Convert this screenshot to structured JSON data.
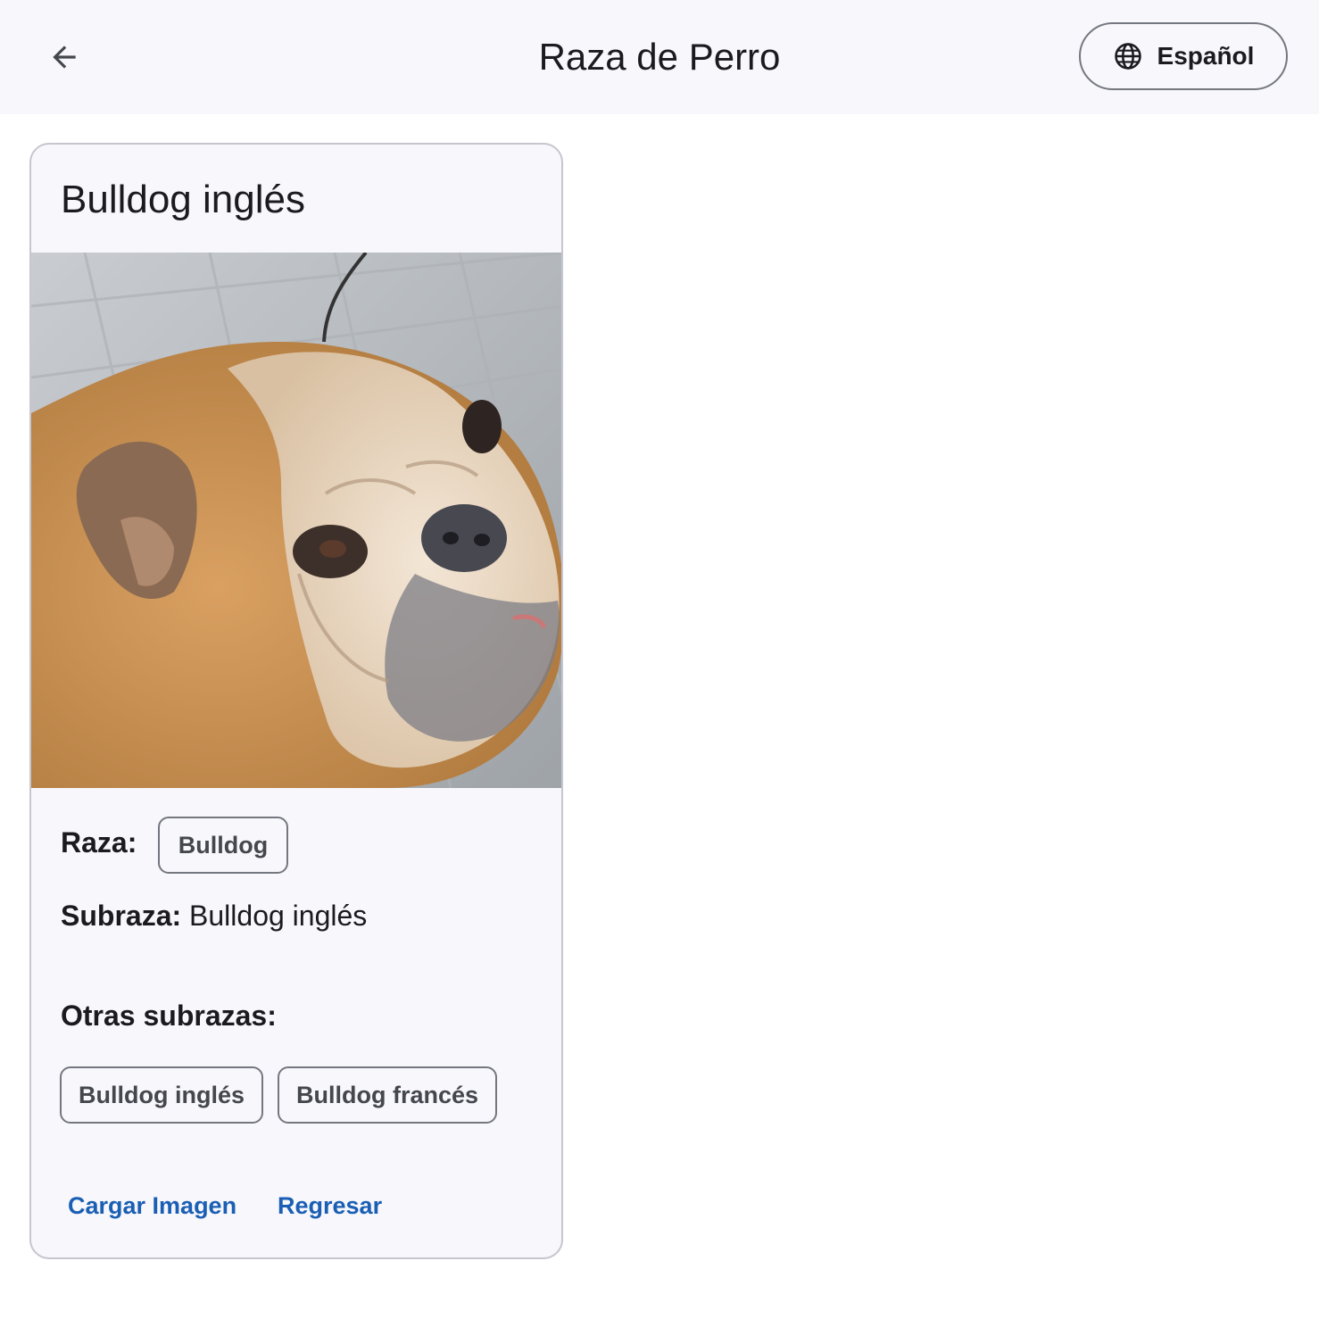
{
  "appbar": {
    "back_icon": "arrow-left-icon",
    "title": "Raza de Perro",
    "language_icon": "globe-icon",
    "language_label": "Español"
  },
  "card": {
    "title": "Bulldog inglés",
    "raza_label": "Raza:",
    "raza_chip": "Bulldog",
    "subraza_label": "Subraza:",
    "subraza_value": "Bulldog inglés",
    "otras_label": "Otras subrazas:",
    "subbreeds": [
      "Bulldog inglés",
      "Bulldog francés"
    ],
    "actions": {
      "upload_label": "Cargar Imagen",
      "back_label": "Regresar"
    }
  },
  "colors": {
    "primary": "#1a5fb4",
    "surface": "#f8f7fb",
    "outline": "#74777f"
  }
}
